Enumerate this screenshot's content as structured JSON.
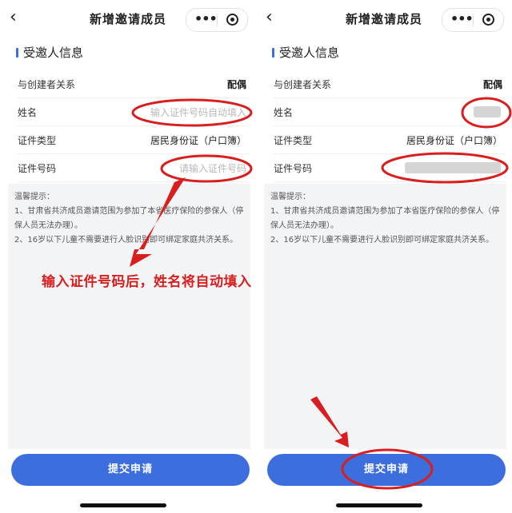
{
  "left": {
    "nav": {
      "back": "‹",
      "title": "新增邀请成员"
    },
    "section_title": "受邀人信息",
    "fields": [
      {
        "label": "与创建者关系",
        "value": "配偶"
      },
      {
        "label": "姓名",
        "placeholder": "输入证件号码自动填入"
      },
      {
        "label": "证件类型",
        "value": "居民身份证（户口簿）"
      },
      {
        "label": "证件号码",
        "placeholder": "请输入证件号码"
      }
    ],
    "notice": {
      "title": "温馨提示：",
      "line1": "1、甘肃省共济成员邀请范围为参加了本省医疗保险的参保人（停保人员无法办理）。",
      "line2": "2、16岁以下儿童不需要进行人脸识别即可绑定家庭共济关系。"
    },
    "callout": "输入证件号码后，姓名将自动填入",
    "submit": "提交申请"
  },
  "right": {
    "nav": {
      "back": "‹",
      "title": "新增邀请成员"
    },
    "section_title": "受邀人信息",
    "fields": [
      {
        "label": "与创建者关系",
        "value": "配偶"
      },
      {
        "label": "姓名"
      },
      {
        "label": "证件类型",
        "value": "居民身份证（户口簿）"
      },
      {
        "label": "证件号码"
      }
    ],
    "notice": {
      "title": "温馨提示：",
      "line1": "1、甘肃省共济成员邀请范围为参加了本省医疗保险的参保人（停保人员无法办理）。",
      "line2": "2、16岁以下儿童不需要进行人脸识别即可绑定家庭共济关系。"
    },
    "submit": "提交申请"
  },
  "icons": {
    "more": "more-dots-icon",
    "close": "close-circle-icon",
    "back": "chevron-left-icon"
  },
  "colors": {
    "accent": "#3c6fdd",
    "annotation": "#d81e1e",
    "notice_bg": "#f3f4f6"
  }
}
